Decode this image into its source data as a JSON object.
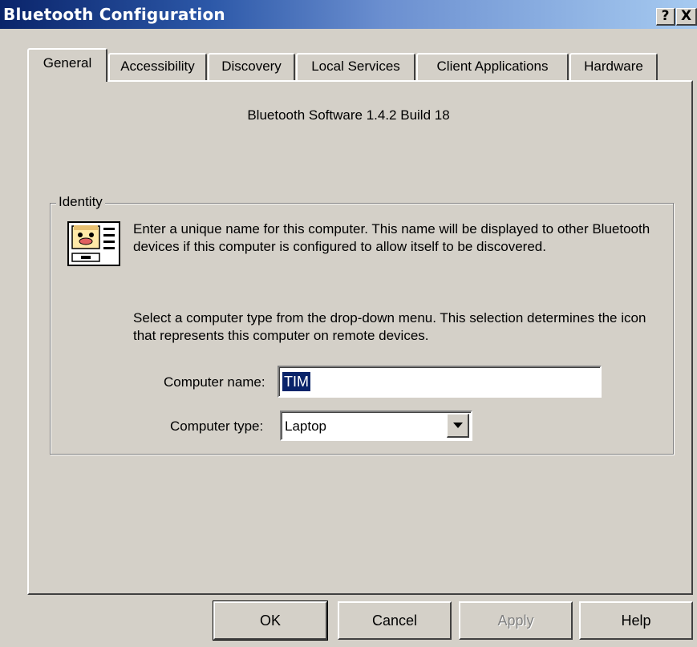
{
  "window": {
    "title": "Bluetooth Configuration",
    "help_label": "?",
    "close_label": "X"
  },
  "tabs": [
    {
      "label": "General",
      "active": true
    },
    {
      "label": "Accessibility",
      "active": false
    },
    {
      "label": "Discovery",
      "active": false
    },
    {
      "label": "Local Services",
      "active": false
    },
    {
      "label": "Client Applications",
      "active": false
    },
    {
      "label": "Hardware",
      "active": false
    }
  ],
  "general": {
    "version_text": "Bluetooth Software 1.4.2 Build 18",
    "identity": {
      "group_label": "Identity",
      "icon": "computer-identity-icon",
      "description1": "Enter a unique name for this computer.  This name will be displayed to other Bluetooth devices if this computer is configured to allow itself to be discovered.",
      "description2": "Select a computer type from the drop-down menu.  This selection determines the icon that represents this computer on remote devices.",
      "computer_name_label": "Computer name:",
      "computer_name_value": "TIM",
      "computer_type_label": "Computer type:",
      "computer_type_value": "Laptop"
    }
  },
  "buttons": {
    "ok": "OK",
    "cancel": "Cancel",
    "apply": "Apply",
    "help": "Help"
  },
  "colors": {
    "title_gradient_start": "#0a246a",
    "title_gradient_end": "#a6caf0",
    "face": "#d4d0c8",
    "selection": "#0a246a"
  }
}
